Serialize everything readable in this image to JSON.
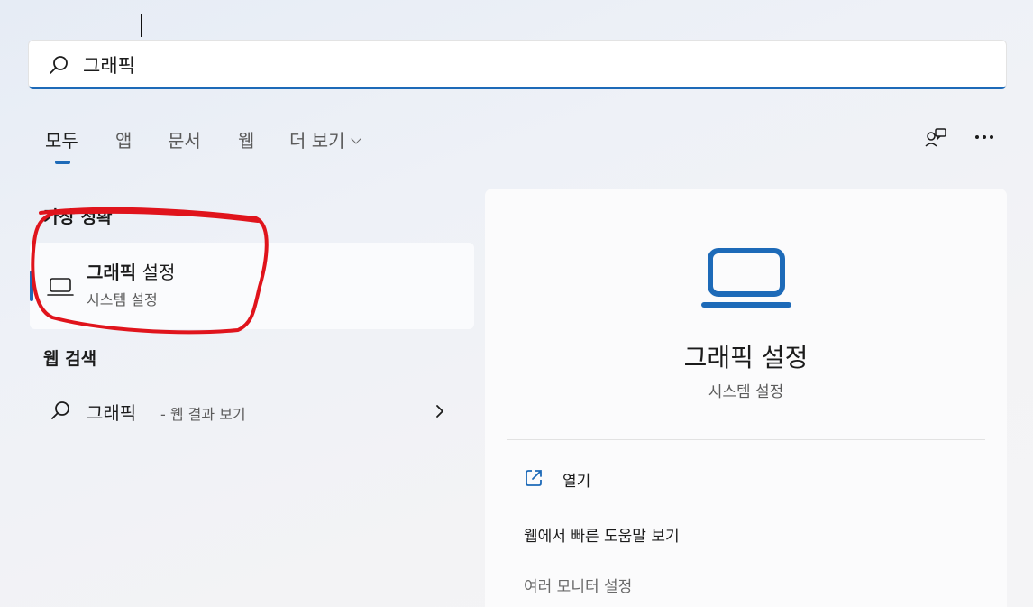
{
  "search": {
    "value": "그래픽",
    "icon": "search-icon"
  },
  "tabs": [
    {
      "label": "모두",
      "active": true
    },
    {
      "label": "앱"
    },
    {
      "label": "문서"
    },
    {
      "label": "웹"
    },
    {
      "label": "더 보기"
    }
  ],
  "header_icons": [
    "feedback-icon",
    "more-options-icon"
  ],
  "best_match": {
    "heading": "가장 정확",
    "title_bold": "그래픽",
    "title_rest": " 설정",
    "subtitle": "시스템 설정",
    "icon": "laptop-icon"
  },
  "web_search": {
    "heading": "웹 검색",
    "query": "그래픽",
    "suffix": "- 웹 결과 보기"
  },
  "detail": {
    "title": "그래픽 설정",
    "subtitle": "시스템 설정",
    "actions": [
      {
        "label": "열기",
        "icon": "open-external-icon"
      },
      {
        "label": "웹에서 빠른 도움말 보기"
      },
      {
        "label": "여러 모니터 설정"
      }
    ]
  },
  "colors": {
    "accent": "#1d6ab8",
    "annotation": "#e0141c"
  }
}
